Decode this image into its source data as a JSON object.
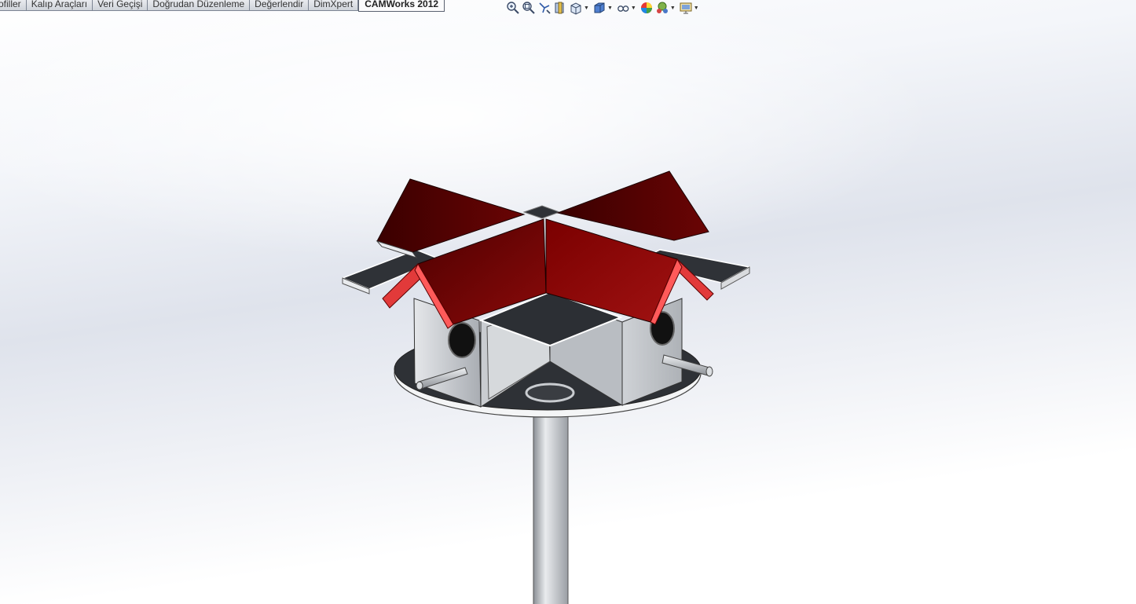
{
  "tabs": [
    {
      "label": "ofiller",
      "active": false
    },
    {
      "label": "Kalıp Araçları",
      "active": false
    },
    {
      "label": "Veri Geçişi",
      "active": false
    },
    {
      "label": "Doğrudan Düzenleme",
      "active": false
    },
    {
      "label": "Değerlendir",
      "active": false
    },
    {
      "label": "DimXpert",
      "active": false
    },
    {
      "label": "CAMWorks 2012",
      "active": true
    }
  ],
  "view_toolbar": [
    {
      "icon": "zoom-to-fit-icon",
      "dropdown": false
    },
    {
      "icon": "zoom-to-area-icon",
      "dropdown": false
    },
    {
      "icon": "previous-view-icon",
      "dropdown": false
    },
    {
      "icon": "section-view-icon",
      "dropdown": false
    },
    {
      "icon": "view-orientation-icon",
      "dropdown": true
    },
    {
      "icon": "display-style-icon",
      "dropdown": true
    },
    {
      "icon": "hide-show-items-icon",
      "dropdown": true
    },
    {
      "icon": "edit-appearance-icon",
      "dropdown": false
    },
    {
      "icon": "apply-scene-icon",
      "dropdown": true
    },
    {
      "icon": "view-settings-icon",
      "dropdown": true
    }
  ],
  "model": {
    "name": "birdhouse-assembly",
    "colors": {
      "roof": "#7a0000",
      "roof_edge": "#e23a3a",
      "body": "#bfc3c8",
      "base": "#2f3237",
      "pole": "#cfd2d6"
    }
  }
}
